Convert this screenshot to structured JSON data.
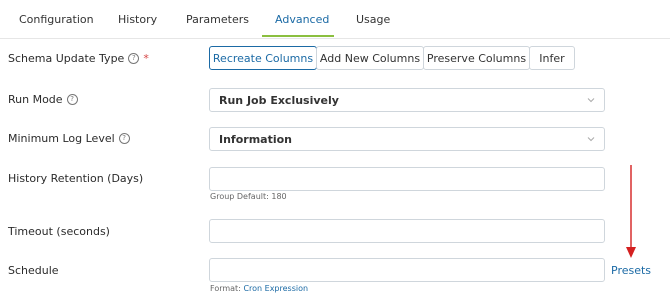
{
  "tabs": [
    {
      "label": "Configuration",
      "active": false
    },
    {
      "label": "History",
      "active": false
    },
    {
      "label": "Parameters",
      "active": false
    },
    {
      "label": "Advanced",
      "active": true
    },
    {
      "label": "Usage",
      "active": false
    }
  ],
  "form": {
    "schema_update_type": {
      "label": "Schema Update Type",
      "required_mark": "*",
      "options": [
        "Recreate Columns",
        "Add New Columns",
        "Preserve Columns",
        "Infer"
      ],
      "selected": "Recreate Columns"
    },
    "run_mode": {
      "label": "Run Mode",
      "value": "Run Job Exclusively"
    },
    "minimum_log_level": {
      "label": "Minimum Log Level",
      "value": "Information"
    },
    "history_retention": {
      "label": "History Retention (Days)",
      "value": "",
      "hint": "Group Default: 180"
    },
    "timeout": {
      "label": "Timeout (seconds)",
      "value": ""
    },
    "schedule": {
      "label": "Schedule",
      "value": "",
      "hint_prefix": "Format:",
      "hint_link": "Cron Expression",
      "presets_label": "Presets"
    }
  },
  "icons": {
    "help": "help-circle-icon",
    "dropdown": "chevron-down-icon",
    "annotation": "red-down-arrow"
  },
  "colors": {
    "accent": "#1b6aa5",
    "tab_underline": "#8bbf3f",
    "required": "#d64545",
    "annotation_arrow": "#d42020"
  }
}
